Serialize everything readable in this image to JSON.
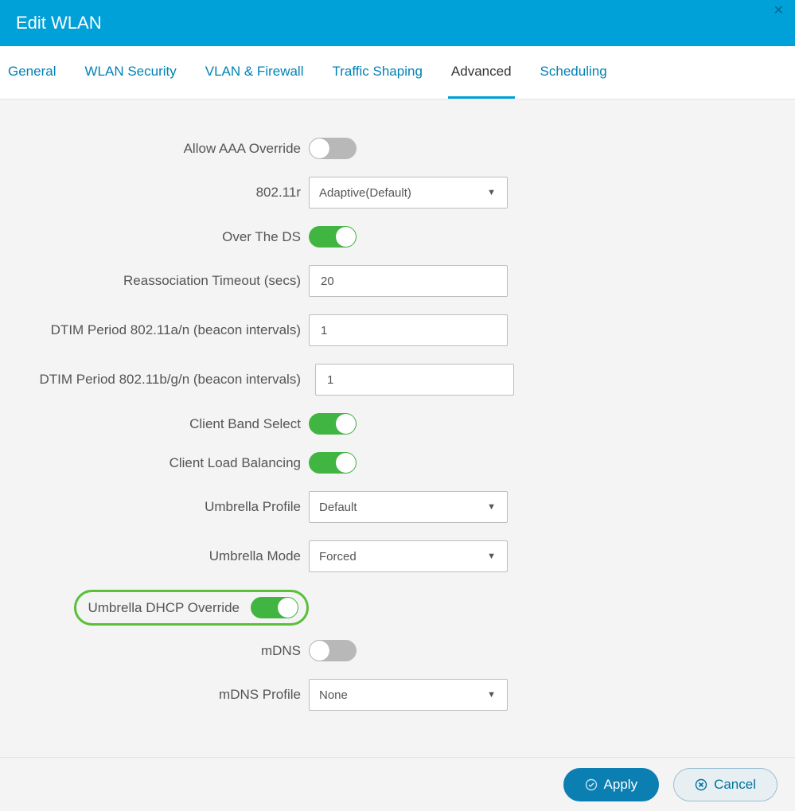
{
  "header": {
    "title": "Edit WLAN"
  },
  "tabs": [
    {
      "label": "General"
    },
    {
      "label": "WLAN Security"
    },
    {
      "label": "VLAN & Firewall"
    },
    {
      "label": "Traffic Shaping"
    },
    {
      "label": "Advanced"
    },
    {
      "label": "Scheduling"
    }
  ],
  "fields": {
    "aaa": {
      "label": "Allow AAA Override",
      "on": false
    },
    "r80211": {
      "label": "802.11r",
      "value": "Adaptive(Default)"
    },
    "overds": {
      "label": "Over The DS",
      "on": true
    },
    "reassoc": {
      "label": "Reassociation Timeout (secs)",
      "value": "20"
    },
    "dtim_a": {
      "label": "DTIM Period 802.11a/n (beacon intervals)",
      "value": "1"
    },
    "dtim_b": {
      "label": "DTIM Period 802.11b/g/n (beacon intervals)",
      "value": "1"
    },
    "band": {
      "label": "Client Band Select",
      "on": true
    },
    "load": {
      "label": "Client Load Balancing",
      "on": true
    },
    "uprof": {
      "label": "Umbrella Profile",
      "value": "Default"
    },
    "umode": {
      "label": "Umbrella Mode",
      "value": "Forced"
    },
    "udhcp": {
      "label": "Umbrella DHCP Override",
      "on": true
    },
    "mdns": {
      "label": "mDNS",
      "on": false
    },
    "mdnsp": {
      "label": "mDNS Profile",
      "value": "None"
    }
  },
  "buttons": {
    "apply": "Apply",
    "cancel": "Cancel"
  }
}
